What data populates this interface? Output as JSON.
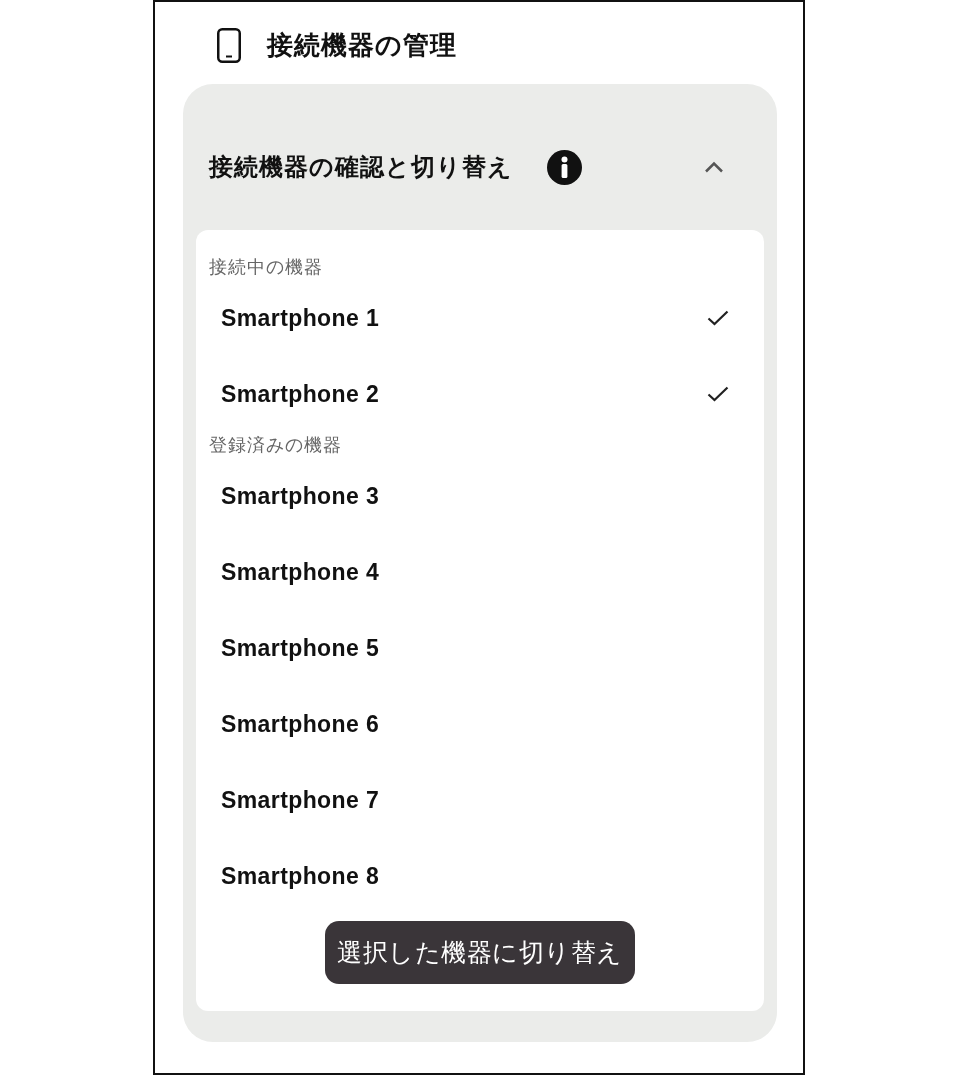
{
  "header": {
    "title": "接続機器の管理"
  },
  "section": {
    "title": "接続機器の確認と切り替え",
    "expanded": true,
    "groups": [
      {
        "label": "接続中の機器",
        "devices": [
          {
            "name": "Smartphone 1",
            "selected": true
          },
          {
            "name": "Smartphone 2",
            "selected": true
          }
        ]
      },
      {
        "label": "登録済みの機器",
        "devices": [
          {
            "name": "Smartphone 3",
            "selected": false
          },
          {
            "name": "Smartphone 4",
            "selected": false
          },
          {
            "name": "Smartphone 5",
            "selected": false
          },
          {
            "name": "Smartphone 6",
            "selected": false
          },
          {
            "name": "Smartphone 7",
            "selected": false
          },
          {
            "name": "Smartphone 8",
            "selected": false
          }
        ]
      }
    ],
    "action_button": {
      "label": "選択した機器に切り替え"
    }
  }
}
